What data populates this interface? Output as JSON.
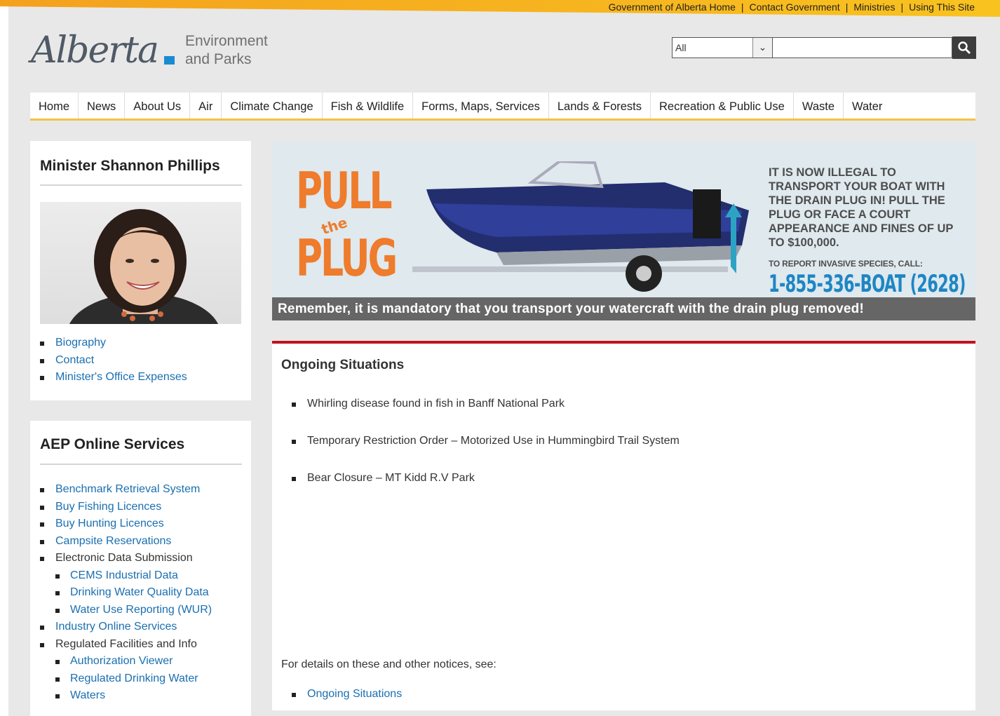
{
  "header": {
    "top_links": [
      "Government of Alberta Home",
      "Contact Government",
      "Ministries",
      "Using This Site"
    ],
    "separator": "|",
    "logo_word": "Alberta",
    "department_line1": "Environment",
    "department_line2": "and Parks",
    "search": {
      "scope_value": "All",
      "query_value": "",
      "button_icon": "magnifier-icon"
    }
  },
  "nav": {
    "items": [
      "Home",
      "News",
      "About Us",
      "Air",
      "Climate Change",
      "Fish & Wildlife",
      "Forms, Maps, Services",
      "Lands & Forests",
      "Recreation & Public Use",
      "Waste",
      "Water"
    ]
  },
  "minister": {
    "title": "Minister Shannon Phillips",
    "links": [
      "Biography",
      "Contact",
      "Minister's Office Expenses"
    ]
  },
  "aep": {
    "title": "AEP Online Services",
    "items": [
      {
        "label": "Benchmark Retrieval System",
        "type": "link",
        "level": 1
      },
      {
        "label": "Buy Fishing Licences",
        "type": "link",
        "level": 1
      },
      {
        "label": "Buy Hunting Licences",
        "type": "link",
        "level": 1
      },
      {
        "label": "Campsite Reservations",
        "type": "link",
        "level": 1
      },
      {
        "label": "Electronic Data Submission",
        "type": "text",
        "level": 1
      },
      {
        "label": "CEMS Industrial Data",
        "type": "link",
        "level": 2
      },
      {
        "label": "Drinking Water Quality Data",
        "type": "link",
        "level": 2
      },
      {
        "label": "Water Use Reporting (WUR)",
        "type": "link",
        "level": 2
      },
      {
        "label": "Industry Online Services",
        "type": "link",
        "level": 1
      },
      {
        "label": "Regulated Facilities and Info",
        "type": "text",
        "level": 1
      },
      {
        "label": "Authorization Viewer",
        "type": "link",
        "level": 2
      },
      {
        "label": "Regulated Drinking Water",
        "type": "link",
        "level": 2
      },
      {
        "label": "Waters",
        "type": "link",
        "level": 2
      }
    ]
  },
  "banner": {
    "word1": "PULL",
    "word_the": "the",
    "word2": "PLUG",
    "warning": "IT IS NOW ILLEGAL TO TRANSPORT YOUR BOAT WITH THE DRAIN PLUG IN! PULL THE PLUG OR FACE A COURT APPEARANCE AND FINES OF UP TO $100,000.",
    "call_text": "TO REPORT INVASIVE SPECIES, CALL:",
    "phone": "1-855-336-BOAT (2628)",
    "caption": "Remember, it is mandatory that you transport your watercraft with the drain plug removed!"
  },
  "ongoing": {
    "title": "Ongoing Situations",
    "items": [
      "Whirling disease found in fish in Banff National Park",
      "Temporary Restriction Order – Motorized Use in Hummingbird Trail System",
      "Bear Closure – MT Kidd R.V Park"
    ],
    "details_text": "For details on these and other notices, see:",
    "more_link": "Ongoing Situations"
  },
  "colors": {
    "accent_orange": "#f4a11e",
    "link_blue": "#1a6fb0",
    "alert_red": "#c0121f",
    "nav_underline": "#f5c242"
  }
}
